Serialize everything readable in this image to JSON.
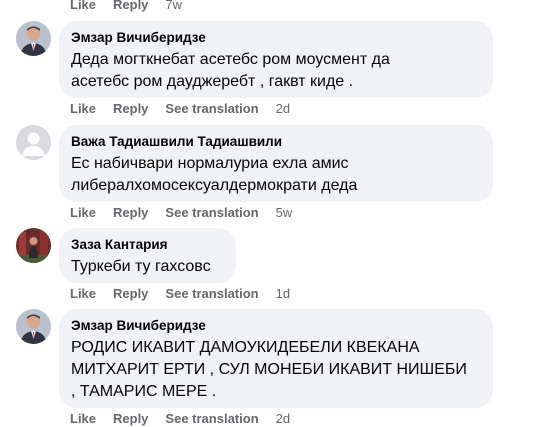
{
  "actions": {
    "like": "Like",
    "reply": "Reply",
    "see_translation": "See translation"
  },
  "top_actions": {
    "like": "Like",
    "reply": "Reply",
    "time": "7w"
  },
  "comments": [
    {
      "author": "Эмзар Вичиберидзе",
      "lines": [
        "Деда могткнебат асетебс ром моусмент да",
        "асетебс ром дауджеребт , гаквт киде ."
      ],
      "time": "2d"
    },
    {
      "author": "Важа Тадиашвили Тадиашвили",
      "lines": [
        "Ес набичвари нормалуриа ехла амис",
        "либералхомосексуалдермократи деда"
      ],
      "time": "5w"
    },
    {
      "author": "Заза Кантария",
      "lines": [
        "Туркеби ту гахсовс"
      ],
      "time": "1d"
    },
    {
      "author": "Эмзар Вичиберидзе",
      "lines": [
        "РОДИС ИКАВИТ ДАМОУКИДЕБЕЛИ КВЕКАНА",
        "МИТХАРИТ ЕРТИ , СУЛ МОНЕБИ ИКАВИТ НИШЕБИ",
        ", ТАМАРИС МЕРЕ ."
      ],
      "time": "2d"
    }
  ],
  "colors": {
    "bubble": "#f0f2f5",
    "meta": "#65676b",
    "text": "#050505"
  }
}
